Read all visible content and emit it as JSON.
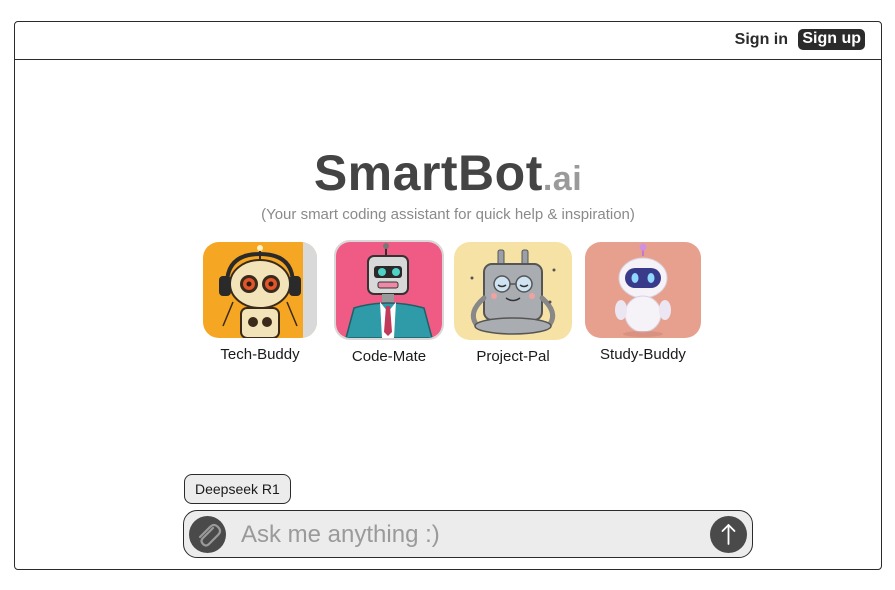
{
  "header": {
    "signin_label": "Sign in",
    "signup_label": "Sign up"
  },
  "hero": {
    "brand_main": "SmartBot",
    "brand_tld": ".ai",
    "tagline": "(Your smart coding assistant for quick help & inspiration)"
  },
  "bots": [
    {
      "label": "Tech-Buddy",
      "icon": "robot-headphones-icon",
      "color": "#f5a623"
    },
    {
      "label": "Code-Mate",
      "icon": "robot-suit-icon",
      "color": "#ef5b84"
    },
    {
      "label": "Project-Pal",
      "icon": "robot-meditating-icon",
      "color": "#f7e2a6"
    },
    {
      "label": "Study-Buddy",
      "icon": "robot-cute-icon",
      "color": "#e8a08e"
    }
  ],
  "composer": {
    "model": "Deepseek R1",
    "placeholder": "Ask me anything :)",
    "attach_icon": "paperclip-icon",
    "send_icon": "arrow-up-icon"
  },
  "colors": {
    "dark": "#2b2b2b",
    "input_bg": "#ececec"
  }
}
